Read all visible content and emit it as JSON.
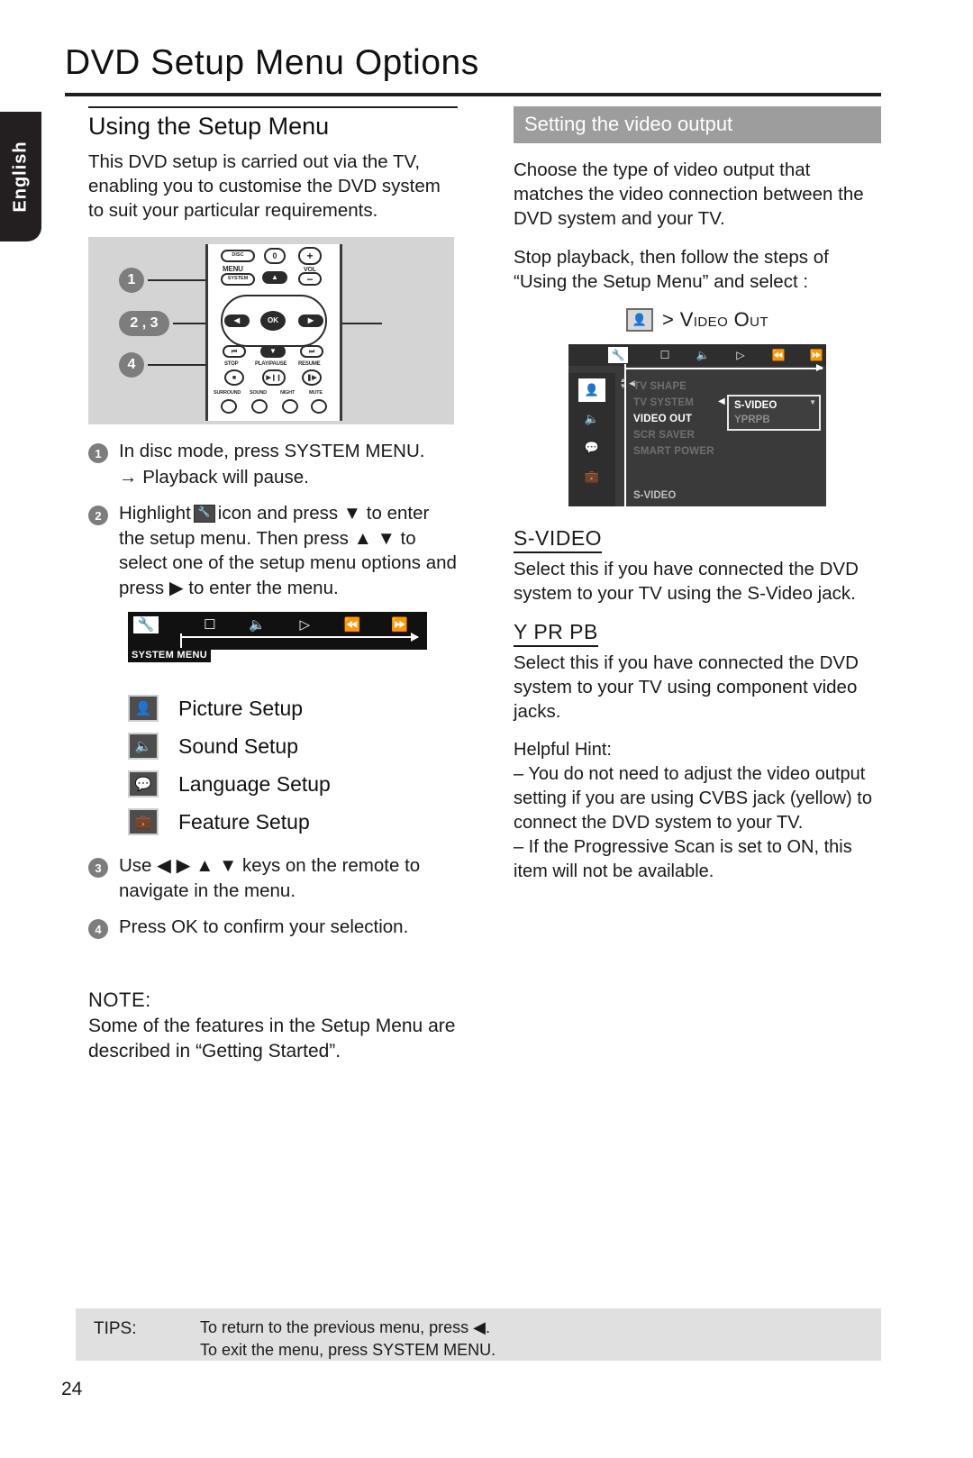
{
  "language_tab": "English",
  "doc_title": "DVD Setup Menu Options",
  "page_number": "24",
  "left": {
    "heading": "Using the Setup Menu",
    "intro": "This DVD setup is carried out via the TV, enabling you to customise the DVD system to suit your particular requirements.",
    "remote": {
      "callouts": [
        "1",
        "2 , 3",
        "4"
      ],
      "buttons": {
        "disc_menu": "DISC MENU",
        "system": "SYSTEM",
        "zero": "0",
        "vol": "VOL",
        "plus": "+",
        "minus": "–",
        "ok": "OK",
        "stop": "STOP",
        "play_pause": "PLAY/PAUSE",
        "resume": "RESUME",
        "surround": "SURROUND",
        "sound": "SOUND",
        "night": "NIGHT",
        "mute": "MUTE"
      }
    },
    "steps": [
      {
        "num": "1",
        "line1": "In disc mode, press SYSTEM MENU.",
        "line2": "→ Playback will pause."
      },
      {
        "num": "2",
        "text_a": "Highlight",
        "text_b": "icon and press ▼ to enter the setup menu. Then press ▲ ▼ to select one of the setup menu options and press ▶ to enter the menu."
      },
      {
        "num": "3",
        "text": "Use ◀ ▶ ▲ ▼ keys on the remote to navigate in the menu."
      },
      {
        "num": "4",
        "text": "Press OK to confirm your selection."
      }
    ],
    "menubar": {
      "icons": [
        "tools",
        "subtitle",
        "audio",
        "play",
        "rewind",
        "forward"
      ],
      "label": "SYSTEM MENU"
    },
    "setup_items": [
      {
        "icon": "picture-setup-icon",
        "label": "Picture Setup"
      },
      {
        "icon": "sound-setup-icon",
        "label": "Sound Setup"
      },
      {
        "icon": "language-setup-icon",
        "label": "Language Setup"
      },
      {
        "icon": "feature-setup-icon",
        "label": "Feature Setup"
      }
    ],
    "note": {
      "title": "NOTE:",
      "body": "Some of the features in the Setup Menu are described in “Getting Started”."
    }
  },
  "right": {
    "band_heading": "Setting the video output",
    "para1": "Choose the type of video output that matches the video connection between the DVD system and your TV.",
    "para2": "Stop playback, then follow the steps of “Using the Setup Menu” and select :",
    "videoout_line": "> Video Out",
    "osd": {
      "top_icons": [
        "tools",
        "subtitle",
        "audio",
        "play",
        "rewind",
        "forward"
      ],
      "side_icons": [
        "picture",
        "sound",
        "language",
        "feature"
      ],
      "items": [
        "TV SHAPE",
        "TV SYSTEM",
        "VIDEO OUT",
        "SCR SAVER",
        "SMART POWER"
      ],
      "active_item": "VIDEO OUT",
      "dropdown": [
        "S-VIDEO",
        "YPRPB"
      ],
      "dropdown_selected": "S-VIDEO",
      "bottom_label": "S-VIDEO"
    },
    "sections": [
      {
        "title": "S-VIDEO",
        "body": "Select this if you have connected the DVD system to your TV using the S-Video jack."
      },
      {
        "title": "Y PR PB",
        "body": "Select this if you have connected the DVD system to your TV using component video jacks."
      }
    ],
    "hint_title": "Helpful Hint:",
    "hints": [
      "–  You do not need to adjust the video output setting if you are using CVBS jack (yellow) to connect the DVD system to your TV.",
      "–  If the Progressive Scan is set to ON, this item will not be available."
    ]
  },
  "tips": {
    "label": "TIPS:",
    "line1": "To return to the previous menu, press ◀.",
    "line2": "To exit the menu, press SYSTEM MENU."
  }
}
